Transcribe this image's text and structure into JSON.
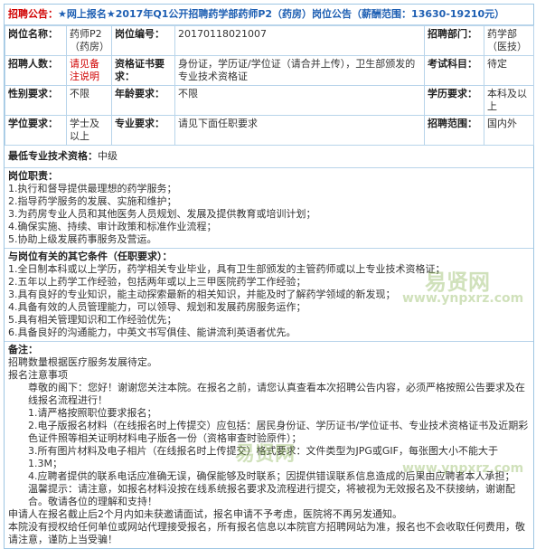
{
  "title": {
    "prefix": "招聘公告：",
    "text": "★网上报名★2017年Q1公开招聘药学部药师P2（药房）岗位公告（薪酬范围：13630-19210元）"
  },
  "rows": {
    "position_name_label": "岗位名称：",
    "position_name": "药师P2（药房）",
    "position_code_label": "岗位编号：",
    "position_code": "20170118021007",
    "dept_label": "招聘部门：",
    "dept": "药学部（医技）",
    "count_label": "招聘人数：",
    "count": "请见备注说明",
    "cert_label": "资格证书要求：",
    "cert": "身份证，学历证/学位证（请合并上传），卫生部颁发的专业技术资格证",
    "exam_label": "考试科目：",
    "exam": "待定",
    "gender_label": "性别要求：",
    "gender": "不限",
    "age_label": "年龄要求：",
    "age": "不限",
    "edu_label": "学历要求：",
    "edu": "本科及以上",
    "degree_label": "学位要求：",
    "degree": "学士及以上",
    "major_label": "专业要求：",
    "major": "请见下面任职要求",
    "scope_label": "招聘范围：",
    "scope": "国内外"
  },
  "qualification": {
    "label": "最低专业技术资格：",
    "value": "中级"
  },
  "duties": {
    "head": "岗位职责：",
    "items": [
      "1.执行和督导提供最理想的药学服务；",
      "2.指导药学服务的发展、实施和维护；",
      "3.为药房专业人员和其他医务人员规划、发展及提供教育或培训计划；",
      "4.确保实施、持续、审计政策和标准作业流程；",
      "5.协助上级发展药事服务及营运。"
    ]
  },
  "conditions": {
    "head": "与岗位有关的其它条件（任职要求）：",
    "items": [
      "1.全日制本科或以上学历，药学相关专业毕业，具有卫生部颁发的主管药师或以上专业技术资格证；",
      "2.五年以上药学工作经验，包括两年或以上三甲医院药学工作经验；",
      "3.具有良好的专业知识，能主动探索最新的相关知识，并能及时了解药学领域的新发现；",
      "4.具备有效的人员管理能力，可以领导、规划和发展药房服务运作；",
      "5.具有相关管理知识和工作经验优先；",
      "6.具备良好的沟通能力，中英文书写俱佳、能讲流利英语者优先。"
    ]
  },
  "notes": {
    "head": "备注：",
    "line1": "招聘数量根据医疗服务发展待定。",
    "line2": "报名注意事项",
    "greeting": "尊敬的阁下：您好！谢谢您关注本院。在报名之前，请您认真查看本次招聘公告内容，必须严格按照公告要求及在线报名流程进行！",
    "n1": "1.请严格按照职位要求报名；",
    "n2": "2.电子版报名材料（在线报名时上传提交）应包括：居民身份证、学历证书/学位证书、专业技术资格证书及近期彩色证件照等相关证明材料电子版各一份（资格审查时验原件）；",
    "n3": "3.所有图片材料及电子相片（在线报名时上传提交）格式要求：文件类型为JPG或GIF，每张图大小不能大于1.3M；",
    "n4": "4.应聘者提供的联系电话应准确无误，确保能够及时联系；因提供错误联系信息造成的后果由应聘者本人承担；",
    "warm": "温馨提示：请注意，如报名材料没按在线系统报名要求及流程进行提交，将被视为无效报名及不获接纳，谢谢配合。敬请各位的理解和支持！",
    "line3": "申请人在报名截止后2个月内如未获邀请面试，报名申请不予考虑，医院将不再另发通知。",
    "line4": "本院没有授权给任何单位或网站代理接受报名，所有报名信息以本院官方招聘网站为准，报名也不会收取任何费用，敬请注意，谨防上当受骗！"
  },
  "watermarks": {
    "w1": "易贤网",
    "w2": "www.ynpxrz.com",
    "w3": "易贤网",
    "w4": "www.ynpxrz.com"
  }
}
